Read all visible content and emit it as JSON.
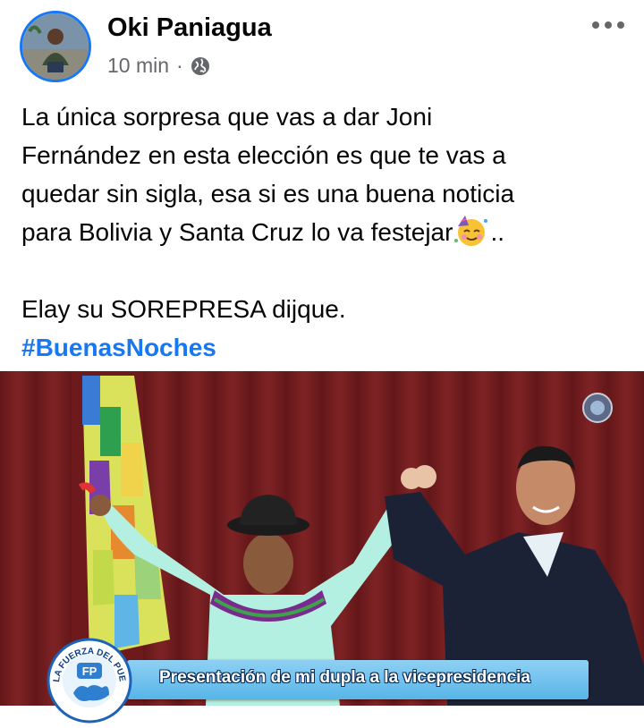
{
  "post": {
    "author": "Oki Paniagua",
    "time": "10 min",
    "separator": "·",
    "privacy_icon": "globe-icon",
    "more_icon": "more-options-icon",
    "text_line1": "La única sorpresa que vas a dar Joni",
    "text_line2": "Fernández en esta elección es que te vas a",
    "text_line3": "quedar sin sigla, esa si es una buena noticia",
    "text_line4": "para Bolivia y Santa Cruz lo va festejar",
    "text_line4_emoji": "partying-face-icon",
    "text_line4_tail": "..",
    "text_line5": "Elay su SOREPRESA dijque.",
    "hashtag": "#BuenasNoches"
  },
  "photo": {
    "caption": "Presentación de mi dupla a la vicepresidencia",
    "logo_text_top": "LA FUERZA DEL PUEBLO",
    "logo_initials": "FP"
  },
  "colors": {
    "accent": "#1877f2",
    "text_primary": "#050505",
    "text_secondary": "#65676b",
    "curtain": "#6e1a1c",
    "caption_bar": "#6fc3ee"
  }
}
